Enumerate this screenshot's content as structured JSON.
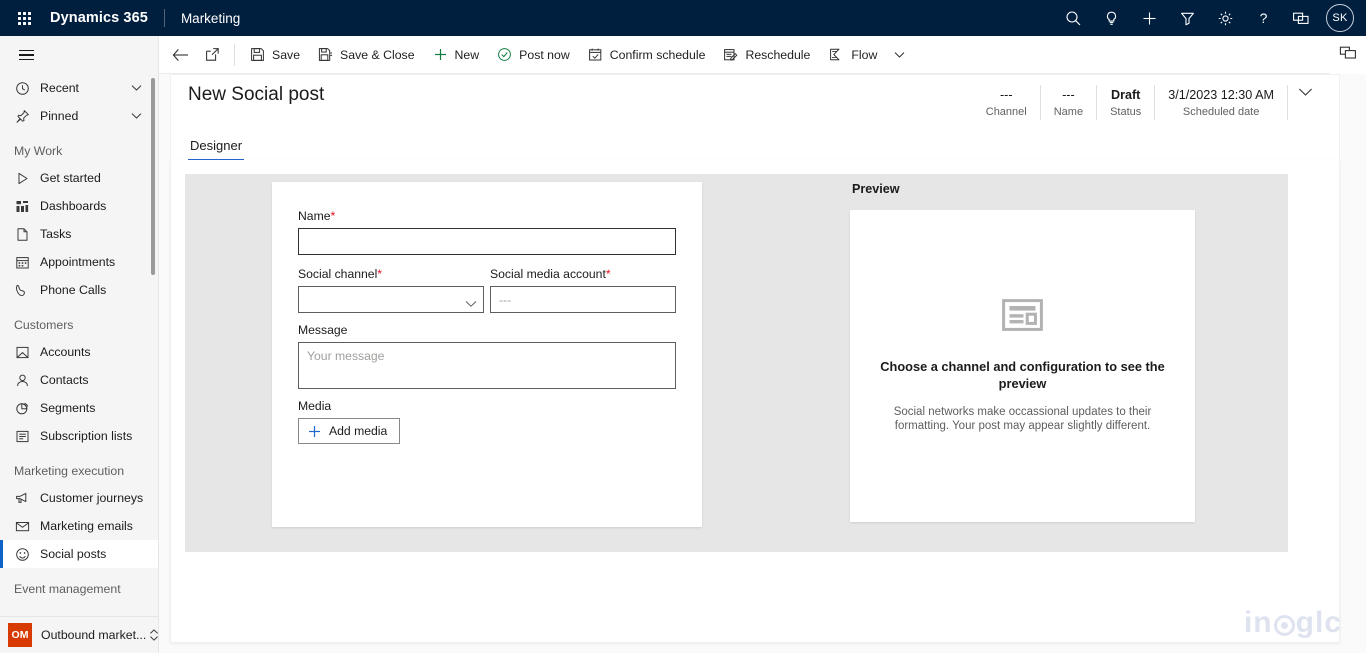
{
  "topbar": {
    "waffle_label": "waffle",
    "brand": "Dynamics 365",
    "app_name": "Marketing",
    "icons": [
      {
        "name": "search-icon",
        "label": "Search"
      },
      {
        "name": "lightbulb-icon",
        "label": "Assistant"
      },
      {
        "name": "plus-icon",
        "label": "Quick create"
      },
      {
        "name": "filter-icon",
        "label": "Filter"
      },
      {
        "name": "gear-icon",
        "label": "Settings"
      },
      {
        "name": "help-icon",
        "label": "Help"
      },
      {
        "name": "feedback-icon",
        "label": "Feedback"
      }
    ],
    "avatar_initials": "SK",
    "avatar_color": "#001f3f"
  },
  "sidebar": {
    "hamburger_label": "Site map",
    "quick": [
      {
        "label": "Recent",
        "icon": "clock-icon",
        "chevron": true
      },
      {
        "label": "Pinned",
        "icon": "pin-icon",
        "chevron": true
      }
    ],
    "groups": [
      {
        "title": "My Work",
        "items": [
          {
            "label": "Get started",
            "icon": "play-icon",
            "selected": false
          },
          {
            "label": "Dashboards",
            "icon": "dashboard-icon",
            "selected": false
          },
          {
            "label": "Tasks",
            "icon": "task-icon",
            "selected": false
          },
          {
            "label": "Appointments",
            "icon": "calendar-icon",
            "selected": false
          },
          {
            "label": "Phone Calls",
            "icon": "phone-icon",
            "selected": false
          }
        ]
      },
      {
        "title": "Customers",
        "items": [
          {
            "label": "Accounts",
            "icon": "account-icon",
            "selected": false
          },
          {
            "label": "Contacts",
            "icon": "contact-icon",
            "selected": false
          },
          {
            "label": "Segments",
            "icon": "segment-icon",
            "selected": false
          },
          {
            "label": "Subscription lists",
            "icon": "subscription-icon",
            "selected": false
          }
        ]
      },
      {
        "title": "Marketing execution",
        "items": [
          {
            "label": "Customer journeys",
            "icon": "megaphone-icon",
            "selected": false
          },
          {
            "label": "Marketing emails",
            "icon": "mail-icon",
            "selected": false
          },
          {
            "label": "Social posts",
            "icon": "social-icon",
            "selected": true
          }
        ]
      },
      {
        "title": "Event management",
        "items": []
      }
    ],
    "app_switcher": {
      "badge": "OM",
      "badge_color": "#d83b01",
      "label": "Outbound market..."
    },
    "selected_accent": "#0f62c8"
  },
  "commandbar": {
    "back_label": "Back",
    "popout_label": "Open in new window",
    "buttons": [
      {
        "label": "Save",
        "icon": "save-icon"
      },
      {
        "label": "Save & Close",
        "icon": "save-close-icon"
      },
      {
        "label": "New",
        "icon": "plus-icon"
      },
      {
        "label": "Post now",
        "icon": "post-now-icon"
      },
      {
        "label": "Confirm schedule",
        "icon": "confirm-schedule-icon"
      },
      {
        "label": "Reschedule",
        "icon": "reschedule-icon"
      },
      {
        "label": "Flow",
        "icon": "flow-icon"
      }
    ],
    "overflow_label": "More commands"
  },
  "right_rail": {
    "panel_icon": "side-panel-icon"
  },
  "record": {
    "title": "New Social post",
    "header_fields": [
      {
        "value": "---",
        "label": "Channel",
        "bold": false
      },
      {
        "value": "---",
        "label": "Name",
        "bold": false
      },
      {
        "value": "Draft",
        "label": "Status",
        "bold": true
      },
      {
        "value": "3/1/2023 12:30 AM",
        "label": "Scheduled date",
        "bold": false
      }
    ],
    "expand_label": "Expand header"
  },
  "tabs": [
    {
      "label": "Designer",
      "active": true
    }
  ],
  "form": {
    "name": {
      "label": "Name",
      "required": true,
      "value": "",
      "placeholder": ""
    },
    "social_channel": {
      "label": "Social channel",
      "required": true,
      "value": "",
      "options": [
        ""
      ]
    },
    "social_media_account": {
      "label": "Social media account",
      "required": true,
      "value": "",
      "placeholder": "---"
    },
    "message": {
      "label": "Message",
      "required": false,
      "value": "",
      "placeholder": "Your message"
    },
    "media": {
      "label": "Media",
      "add_button": "Add media"
    }
  },
  "preview": {
    "title": "Preview",
    "placeholder_icon": "preview-card-icon",
    "heading": "Choose a channel and configuration to see the preview",
    "subtext": "Social networks make occassional updates to their formatting. Your post may appear slightly different."
  },
  "watermark": {
    "prefix": "in",
    "suffix": "glc",
    "color": "#dfe3f0"
  }
}
